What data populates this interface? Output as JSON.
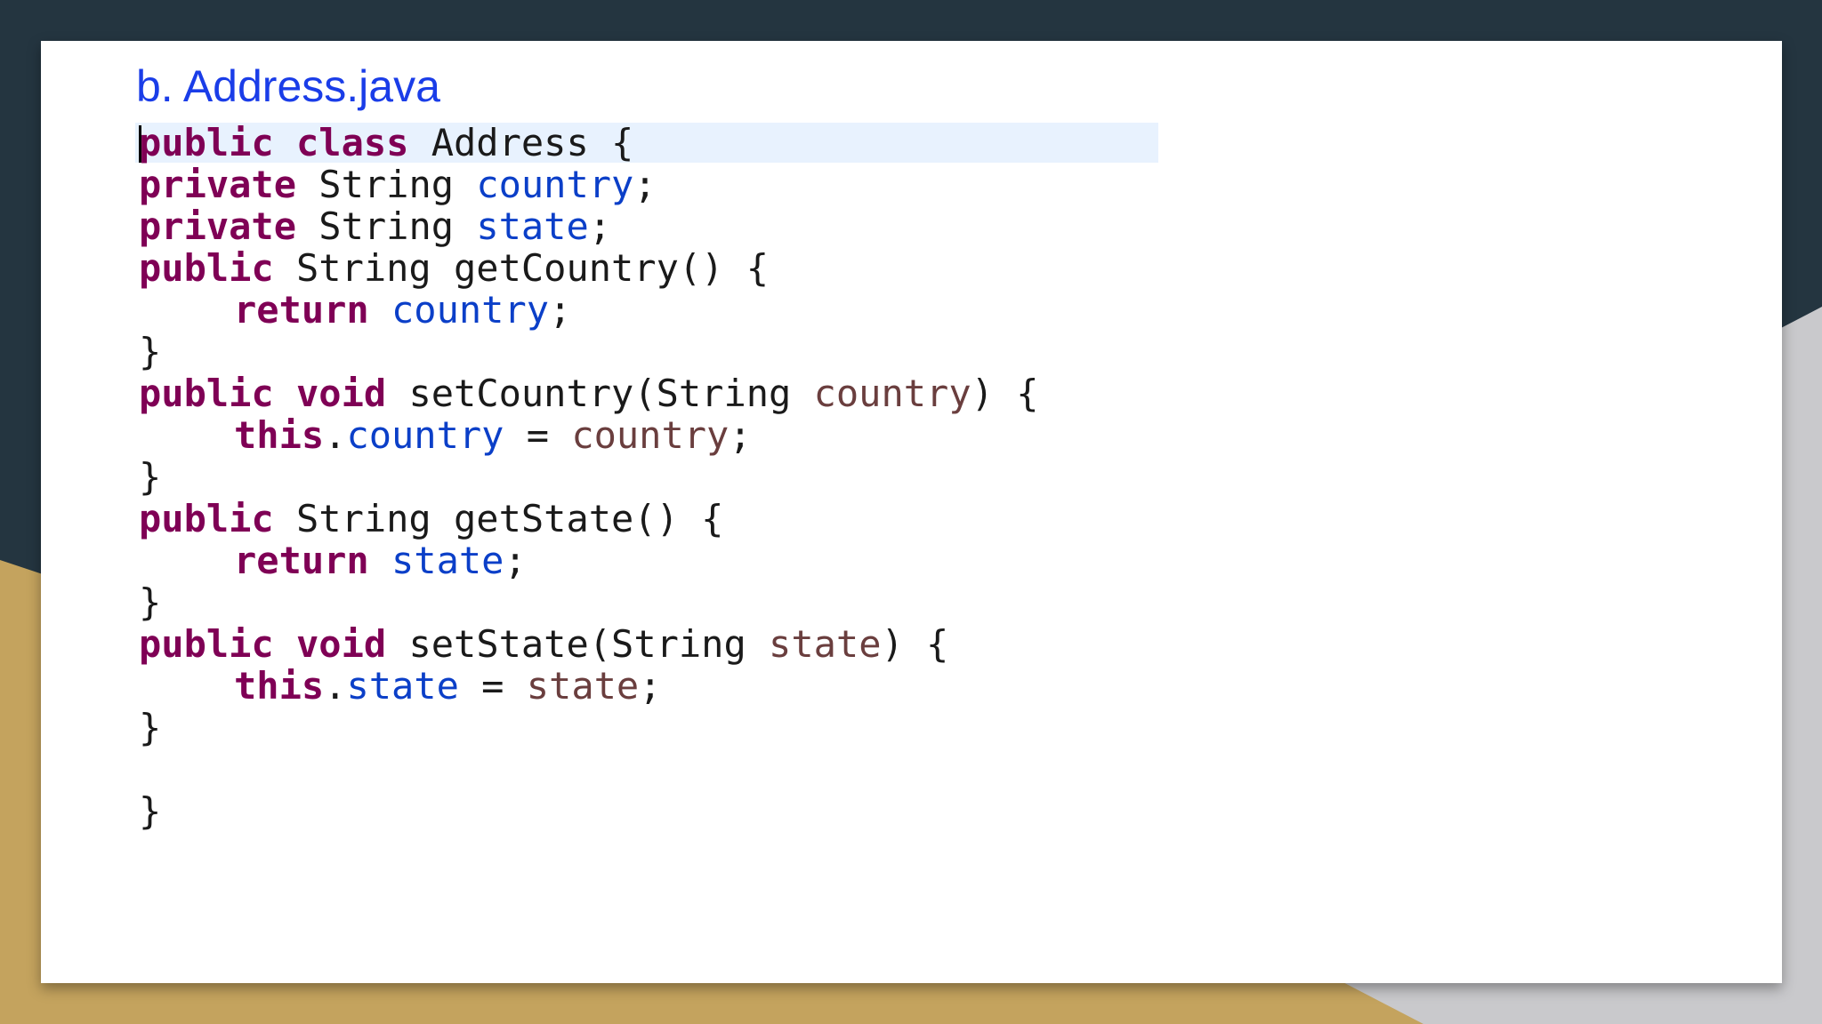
{
  "slide": {
    "title": "b. Address.java"
  },
  "code": {
    "lines": [
      {
        "tokens": [
          {
            "t": "public",
            "c": "kw"
          },
          {
            "t": " ",
            "c": "plain"
          },
          {
            "t": "class",
            "c": "kw"
          },
          {
            "t": " Address {",
            "c": "plain"
          }
        ]
      },
      {
        "tokens": [
          {
            "t": "private",
            "c": "kw"
          },
          {
            "t": " String ",
            "c": "plain"
          },
          {
            "t": "country",
            "c": "fld"
          },
          {
            "t": ";",
            "c": "plain"
          }
        ]
      },
      {
        "tokens": [
          {
            "t": "private",
            "c": "kw"
          },
          {
            "t": " String ",
            "c": "plain"
          },
          {
            "t": "state",
            "c": "fld"
          },
          {
            "t": ";",
            "c": "plain"
          }
        ]
      },
      {
        "tokens": [
          {
            "t": "public",
            "c": "kw"
          },
          {
            "t": " String getCountry() {",
            "c": "plain"
          }
        ]
      },
      {
        "indent": true,
        "tokens": [
          {
            "t": "return",
            "c": "kw"
          },
          {
            "t": " ",
            "c": "plain"
          },
          {
            "t": "country",
            "c": "fld"
          },
          {
            "t": ";",
            "c": "plain"
          }
        ]
      },
      {
        "tokens": [
          {
            "t": "}",
            "c": "plain"
          }
        ]
      },
      {
        "tokens": [
          {
            "t": "public",
            "c": "kw"
          },
          {
            "t": " ",
            "c": "plain"
          },
          {
            "t": "void",
            "c": "kw"
          },
          {
            "t": " setCountry(String ",
            "c": "plain"
          },
          {
            "t": "country",
            "c": "par"
          },
          {
            "t": ") {",
            "c": "plain"
          }
        ]
      },
      {
        "indent": true,
        "tokens": [
          {
            "t": "this",
            "c": "kw"
          },
          {
            "t": ".",
            "c": "plain"
          },
          {
            "t": "country",
            "c": "fld"
          },
          {
            "t": " = ",
            "c": "plain"
          },
          {
            "t": "country",
            "c": "par"
          },
          {
            "t": ";",
            "c": "plain"
          }
        ]
      },
      {
        "tokens": [
          {
            "t": "}",
            "c": "plain"
          }
        ]
      },
      {
        "tokens": [
          {
            "t": "public",
            "c": "kw"
          },
          {
            "t": " String getState() {",
            "c": "plain"
          }
        ]
      },
      {
        "indent": true,
        "tokens": [
          {
            "t": "return",
            "c": "kw"
          },
          {
            "t": " ",
            "c": "plain"
          },
          {
            "t": "state",
            "c": "fld"
          },
          {
            "t": ";",
            "c": "plain"
          }
        ]
      },
      {
        "tokens": [
          {
            "t": "}",
            "c": "plain"
          }
        ]
      },
      {
        "tokens": [
          {
            "t": "public",
            "c": "kw"
          },
          {
            "t": " ",
            "c": "plain"
          },
          {
            "t": "void",
            "c": "kw"
          },
          {
            "t": " setState(String ",
            "c": "plain"
          },
          {
            "t": "state",
            "c": "par"
          },
          {
            "t": ") {",
            "c": "plain"
          }
        ]
      },
      {
        "indent": true,
        "tokens": [
          {
            "t": "this",
            "c": "kw"
          },
          {
            "t": ".",
            "c": "plain"
          },
          {
            "t": "state",
            "c": "fld"
          },
          {
            "t": " = ",
            "c": "plain"
          },
          {
            "t": "state",
            "c": "par"
          },
          {
            "t": ";",
            "c": "plain"
          }
        ]
      },
      {
        "tokens": [
          {
            "t": "}",
            "c": "plain"
          }
        ]
      },
      {
        "tokens": []
      },
      {
        "tokens": [
          {
            "t": "}",
            "c": "plain"
          }
        ]
      }
    ]
  },
  "colors": {
    "background_dark": "#243540",
    "background_gold": "#c4a35e",
    "title": "#1a3de8",
    "keyword": "#7f0055",
    "field": "#0b3fc8",
    "parameter": "#6a3e3e",
    "current_line_highlight": "#e8f2fe"
  }
}
